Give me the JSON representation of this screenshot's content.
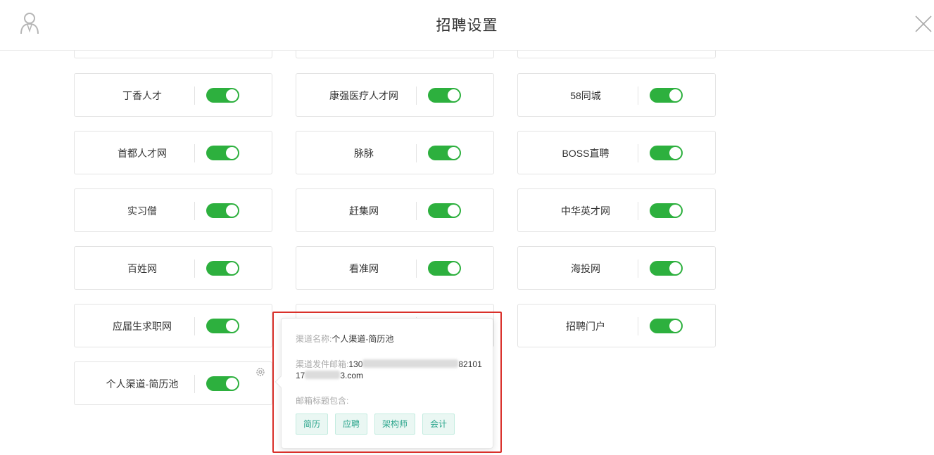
{
  "header": {
    "title": "招聘设置",
    "user_icon": "user-icon",
    "close_icon": "close-icon"
  },
  "channels": [
    {
      "name": "",
      "enabled": true
    },
    {
      "name": "",
      "enabled": true
    },
    {
      "name": "",
      "enabled": true
    },
    {
      "name": "丁香人才",
      "enabled": true
    },
    {
      "name": "康强医疗人才网",
      "enabled": true
    },
    {
      "name": "58同城",
      "enabled": true
    },
    {
      "name": "首都人才网",
      "enabled": true
    },
    {
      "name": "脉脉",
      "enabled": true
    },
    {
      "name": "BOSS直聘",
      "enabled": true
    },
    {
      "name": "实习僧",
      "enabled": true
    },
    {
      "name": "赶集网",
      "enabled": true
    },
    {
      "name": "中华英才网",
      "enabled": true
    },
    {
      "name": "百姓网",
      "enabled": true
    },
    {
      "name": "看准网",
      "enabled": true
    },
    {
      "name": "海投网",
      "enabled": true
    },
    {
      "name": "应届生求职网",
      "enabled": true
    },
    {
      "name": "",
      "enabled": true
    },
    {
      "name": "招聘门户",
      "enabled": true
    },
    {
      "name": "个人渠道-简历池",
      "enabled": true
    }
  ],
  "popover": {
    "channel_label": "渠道名称:",
    "channel_value": "个人渠道-简历池",
    "email_label": "渠道发件邮箱:",
    "email_line1_a": "130",
    "email_line1_b": "82101",
    "email_line2_a": "17",
    "email_line2_b": "3.com",
    "subject_label": "邮箱标题包含:",
    "tags": [
      "简历",
      "应聘",
      "架构师",
      "会计"
    ]
  },
  "colors": {
    "toggle_on": "#2db03e",
    "tag_text": "#2ba58c",
    "highlight": "#d9302a"
  }
}
